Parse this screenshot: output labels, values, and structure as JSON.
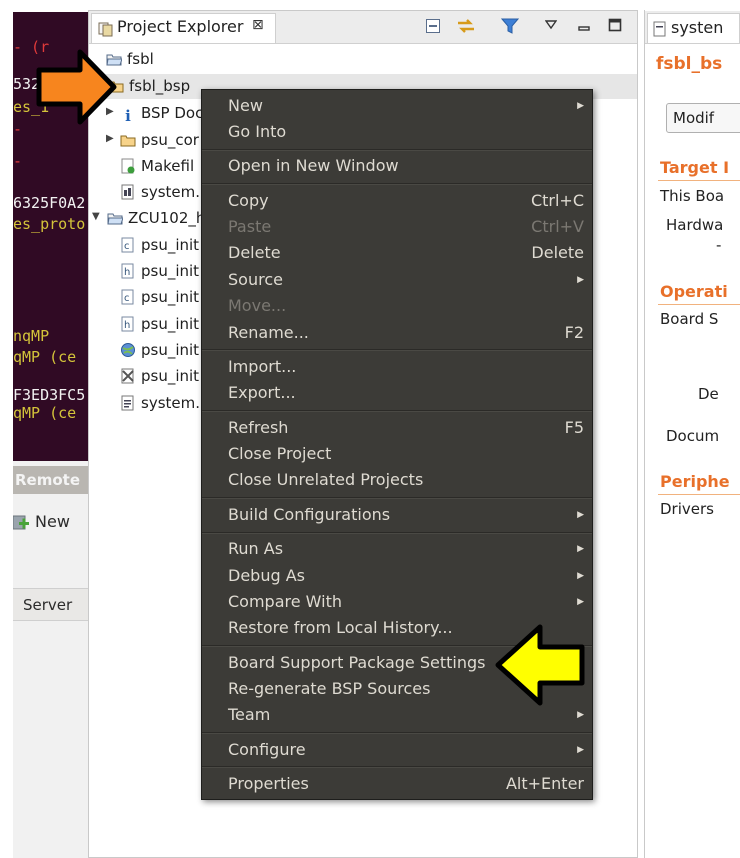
{
  "terminal": {
    "lines": [
      {
        "text": "-   (r",
        "color": "#e03a3a"
      },
      {
        "text": "5325",
        "color": "#f2f2f2"
      },
      {
        "text": "es_1",
        "color": "#d4c43a"
      },
      {
        "text": "-",
        "color": "#e03a3a"
      },
      {
        "text": "-",
        "color": "#e03a3a"
      },
      {
        "text": "6325F0A2",
        "color": "#f2f2f2"
      },
      {
        "text": "es_proto",
        "color": "#d4c43a"
      },
      {
        "text": "nqMP",
        "color": "#d4c43a"
      },
      {
        "text": "qMP  (ce",
        "color": "#d4c43a"
      },
      {
        "text": "F3ED3FC5",
        "color": "#f2f2f2"
      },
      {
        "text": "qMP  (ce",
        "color": "#d4c43a"
      }
    ]
  },
  "left_panel": {
    "remote_tab": "Remote",
    "new_button": "New",
    "server_tab": "Server"
  },
  "explorer": {
    "tab_title": "Project Explorer",
    "close_glyph": "⊠",
    "tree": [
      {
        "label": "fsbl",
        "icon": "folder-project-icon"
      },
      {
        "label": "fsbl_bsp",
        "icon": "folder-project-icon"
      },
      {
        "label": "BSP Doc",
        "icon": "info-icon"
      },
      {
        "label": "psu_cor",
        "icon": "folder-icon"
      },
      {
        "label": "Makefil",
        "icon": "makefile-icon"
      },
      {
        "label": "system.",
        "icon": "file-icon"
      },
      {
        "label": "ZCU102_h",
        "icon": "folder-project-icon"
      },
      {
        "label": "psu_init",
        "icon": "c-file-icon"
      },
      {
        "label": "psu_init",
        "icon": "h-file-icon"
      },
      {
        "label": "psu_init",
        "icon": "c-file-icon"
      },
      {
        "label": "psu_init",
        "icon": "h-file-icon"
      },
      {
        "label": "psu_init",
        "icon": "globe-icon"
      },
      {
        "label": "psu_init",
        "icon": "tcl-file-icon"
      },
      {
        "label": "system.",
        "icon": "file-icon"
      }
    ]
  },
  "editor": {
    "tab_title": "systen",
    "title": "fsbl_bs",
    "modify_button": "Modif",
    "target_heading": "Target I",
    "this_board": "This Boa",
    "hardware": "Hardwa",
    "hardware_dash": "-",
    "operating_heading": "Operati",
    "board_s": "Board S",
    "de": "De",
    "docum": "Docum",
    "peripheral_heading": "Periphe",
    "drivers": "Drivers"
  },
  "context_menu": {
    "items": [
      {
        "label": "New",
        "submenu": true
      },
      {
        "label": "Go Into"
      },
      {
        "label": "Open in New Window"
      },
      {
        "label": "Copy",
        "accel": "Ctrl+C"
      },
      {
        "label": "Paste",
        "accel": "Ctrl+V",
        "disabled": true
      },
      {
        "label": "Delete",
        "accel": "Delete"
      },
      {
        "label": "Source",
        "submenu": true
      },
      {
        "label": "Move...",
        "disabled": true
      },
      {
        "label": "Rename...",
        "accel": "F2"
      },
      {
        "label": "Import..."
      },
      {
        "label": "Export..."
      },
      {
        "label": "Refresh",
        "accel": "F5"
      },
      {
        "label": "Close Project"
      },
      {
        "label": "Close Unrelated Projects"
      },
      {
        "label": "Build Configurations",
        "submenu": true
      },
      {
        "label": "Run As",
        "submenu": true
      },
      {
        "label": "Debug As",
        "submenu": true
      },
      {
        "label": "Compare With",
        "submenu": true
      },
      {
        "label": "Restore from Local History..."
      },
      {
        "label": "Board Support Package Settings"
      },
      {
        "label": "Re-generate BSP Sources"
      },
      {
        "label": "Team",
        "submenu": true
      },
      {
        "label": "Configure",
        "submenu": true
      },
      {
        "label": "Properties",
        "accel": "Alt+Enter"
      }
    ]
  },
  "colors": {
    "menu_bg": "#3c3b37",
    "menu_text": "#dfdbd2",
    "terminal_bg": "#300a24",
    "accent_orange": "#e8702a",
    "orange_arrow": "#f7851e",
    "yellow_arrow": "#ffff00"
  }
}
